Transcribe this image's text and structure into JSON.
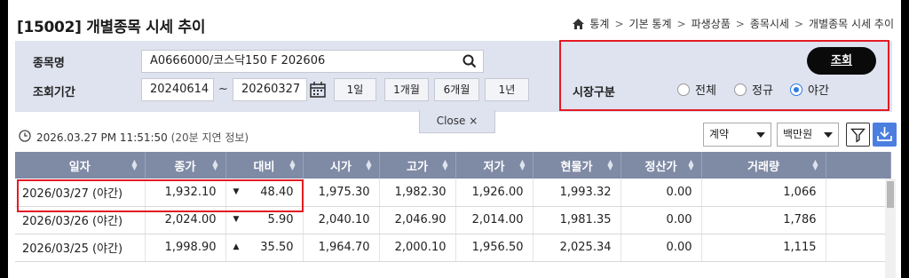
{
  "header": {
    "title": "[15002] 개별종목 시세 추이",
    "breadcrumb": [
      "통계",
      "기본 통계",
      "파생상품",
      "종목시세",
      "개별종목 시세 추이"
    ]
  },
  "search": {
    "item_label": "종목명",
    "item_value": "A0666000/코스닥150 F 202606",
    "period_label": "조회기간",
    "start_date": "20240614",
    "tilde": "~",
    "end_date": "20260327",
    "period_buttons": [
      "1일",
      "1개월",
      "6개월",
      "1년"
    ],
    "market_label": "시장구분",
    "market_options": [
      "전체",
      "정규",
      "야간"
    ],
    "market_selected": "야간",
    "query_button": "조회",
    "close_label": "Close ×"
  },
  "info": {
    "timestamp": "2026.03.27 PM 11:51:50",
    "delay_note": "(20분 지연 정보)",
    "select_type": "계약",
    "select_unit": "백만원"
  },
  "table": {
    "columns": [
      "일자",
      "종가",
      "대비",
      "시가",
      "고가",
      "저가",
      "현물가",
      "정산가",
      "거래량"
    ],
    "rows": [
      {
        "date": "2026/03/27 (야간)",
        "close": "1,932.10",
        "dir": "down",
        "change": "48.40",
        "open": "1,975.30",
        "high": "1,982.30",
        "low": "1,926.00",
        "spot": "1,993.32",
        "settle": "0.00",
        "volume": "1,066"
      },
      {
        "date": "2026/03/26 (야간)",
        "close": "2,024.00",
        "dir": "down",
        "change": "5.90",
        "open": "2,040.10",
        "high": "2,046.90",
        "low": "2,014.00",
        "spot": "1,981.35",
        "settle": "0.00",
        "volume": "1,786"
      },
      {
        "date": "2026/03/25 (야간)",
        "close": "1,998.90",
        "dir": "up",
        "change": "35.50",
        "open": "1,964.70",
        "high": "2,000.10",
        "low": "1,956.50",
        "spot": "2,025.34",
        "settle": "0.00",
        "volume": "1,115"
      }
    ]
  },
  "colors": {
    "panel_bg": "#dfe2ef",
    "table_header": "#7f8aa5",
    "down": "#1f78d1",
    "up": "#e35a2a",
    "highlight": "#e31b23",
    "accent_blue": "#2c7be5"
  }
}
